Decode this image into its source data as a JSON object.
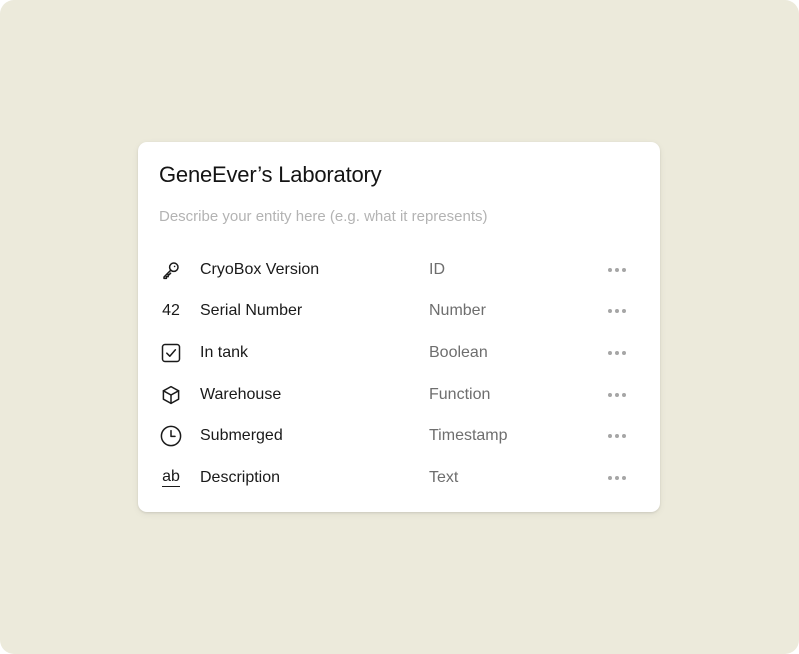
{
  "entity": {
    "title": "GeneEver’s Laboratory",
    "description_placeholder": "Describe your entity here (e.g. what it represents)",
    "description_value": ""
  },
  "fields": [
    {
      "icon": "key-icon",
      "name": "CryoBox Version",
      "type": "ID"
    },
    {
      "icon": "number-icon",
      "icon_text": "42",
      "name": "Serial Number",
      "type": "Number"
    },
    {
      "icon": "checkbox-icon",
      "name": "In tank",
      "type": "Boolean"
    },
    {
      "icon": "cube-icon",
      "name": "Warehouse",
      "type": "Function"
    },
    {
      "icon": "clock-icon",
      "name": "Submerged",
      "type": "Timestamp"
    },
    {
      "icon": "text-icon",
      "icon_text": "ab",
      "name": "Description",
      "type": "Text"
    }
  ],
  "colors": {
    "background": "#eceadb",
    "card": "#ffffff",
    "text_primary": "#141414",
    "text_secondary": "#6e6e6e",
    "placeholder": "#b3b3b3",
    "menu_dots": "#a6a6a6"
  }
}
